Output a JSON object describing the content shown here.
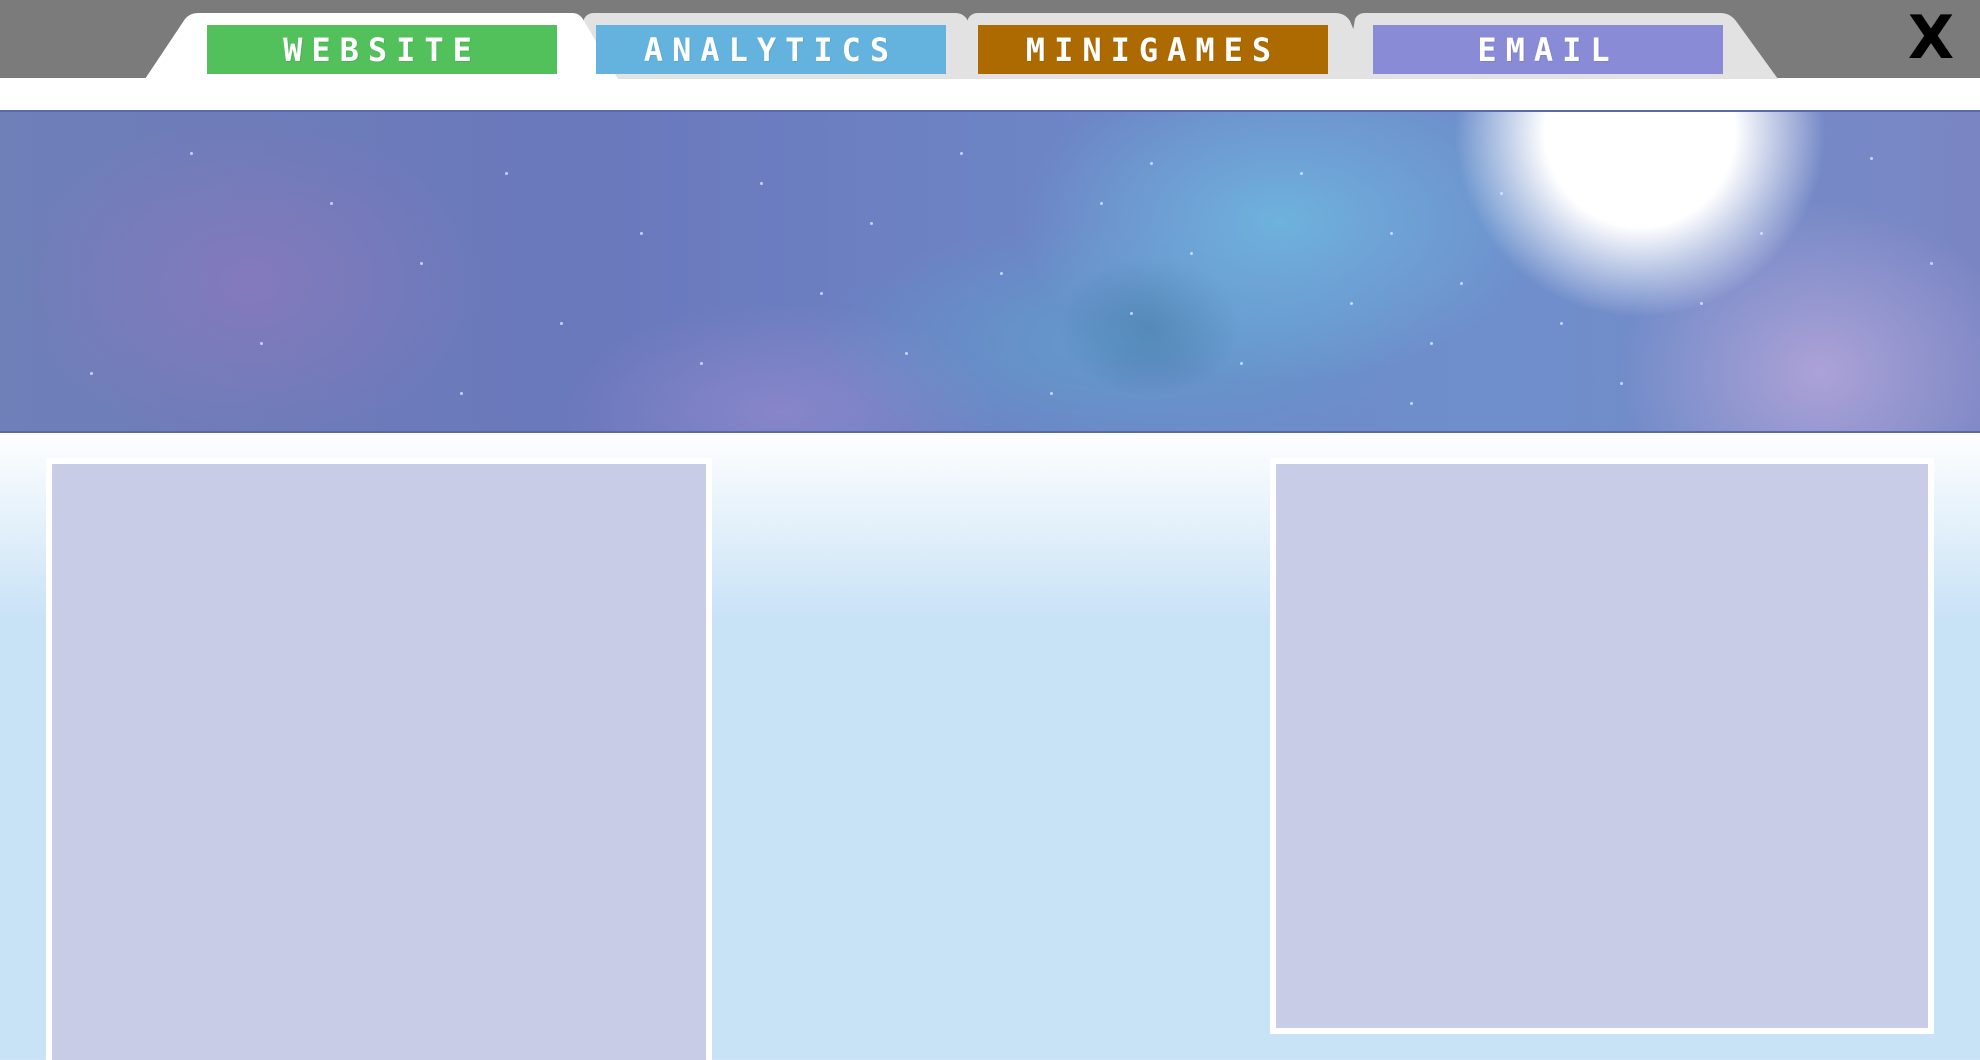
{
  "tabs": [
    {
      "label": "WEBSITE",
      "color": "#52c15b"
    },
    {
      "label": "ANALYTICS",
      "color": "#64b3df"
    },
    {
      "label": "MINIGAMES",
      "color": "#ad6a00"
    },
    {
      "label": "EMAIL",
      "color": "#898bd6"
    }
  ],
  "close": {
    "label": "X"
  },
  "banner": {
    "description_icon": "moon-icon"
  },
  "colors": {
    "topbar": "#7b7b7b",
    "tab_shape": "#e2e2e2",
    "panel": "#c9cce7",
    "page_background": "#c8e2f6"
  }
}
